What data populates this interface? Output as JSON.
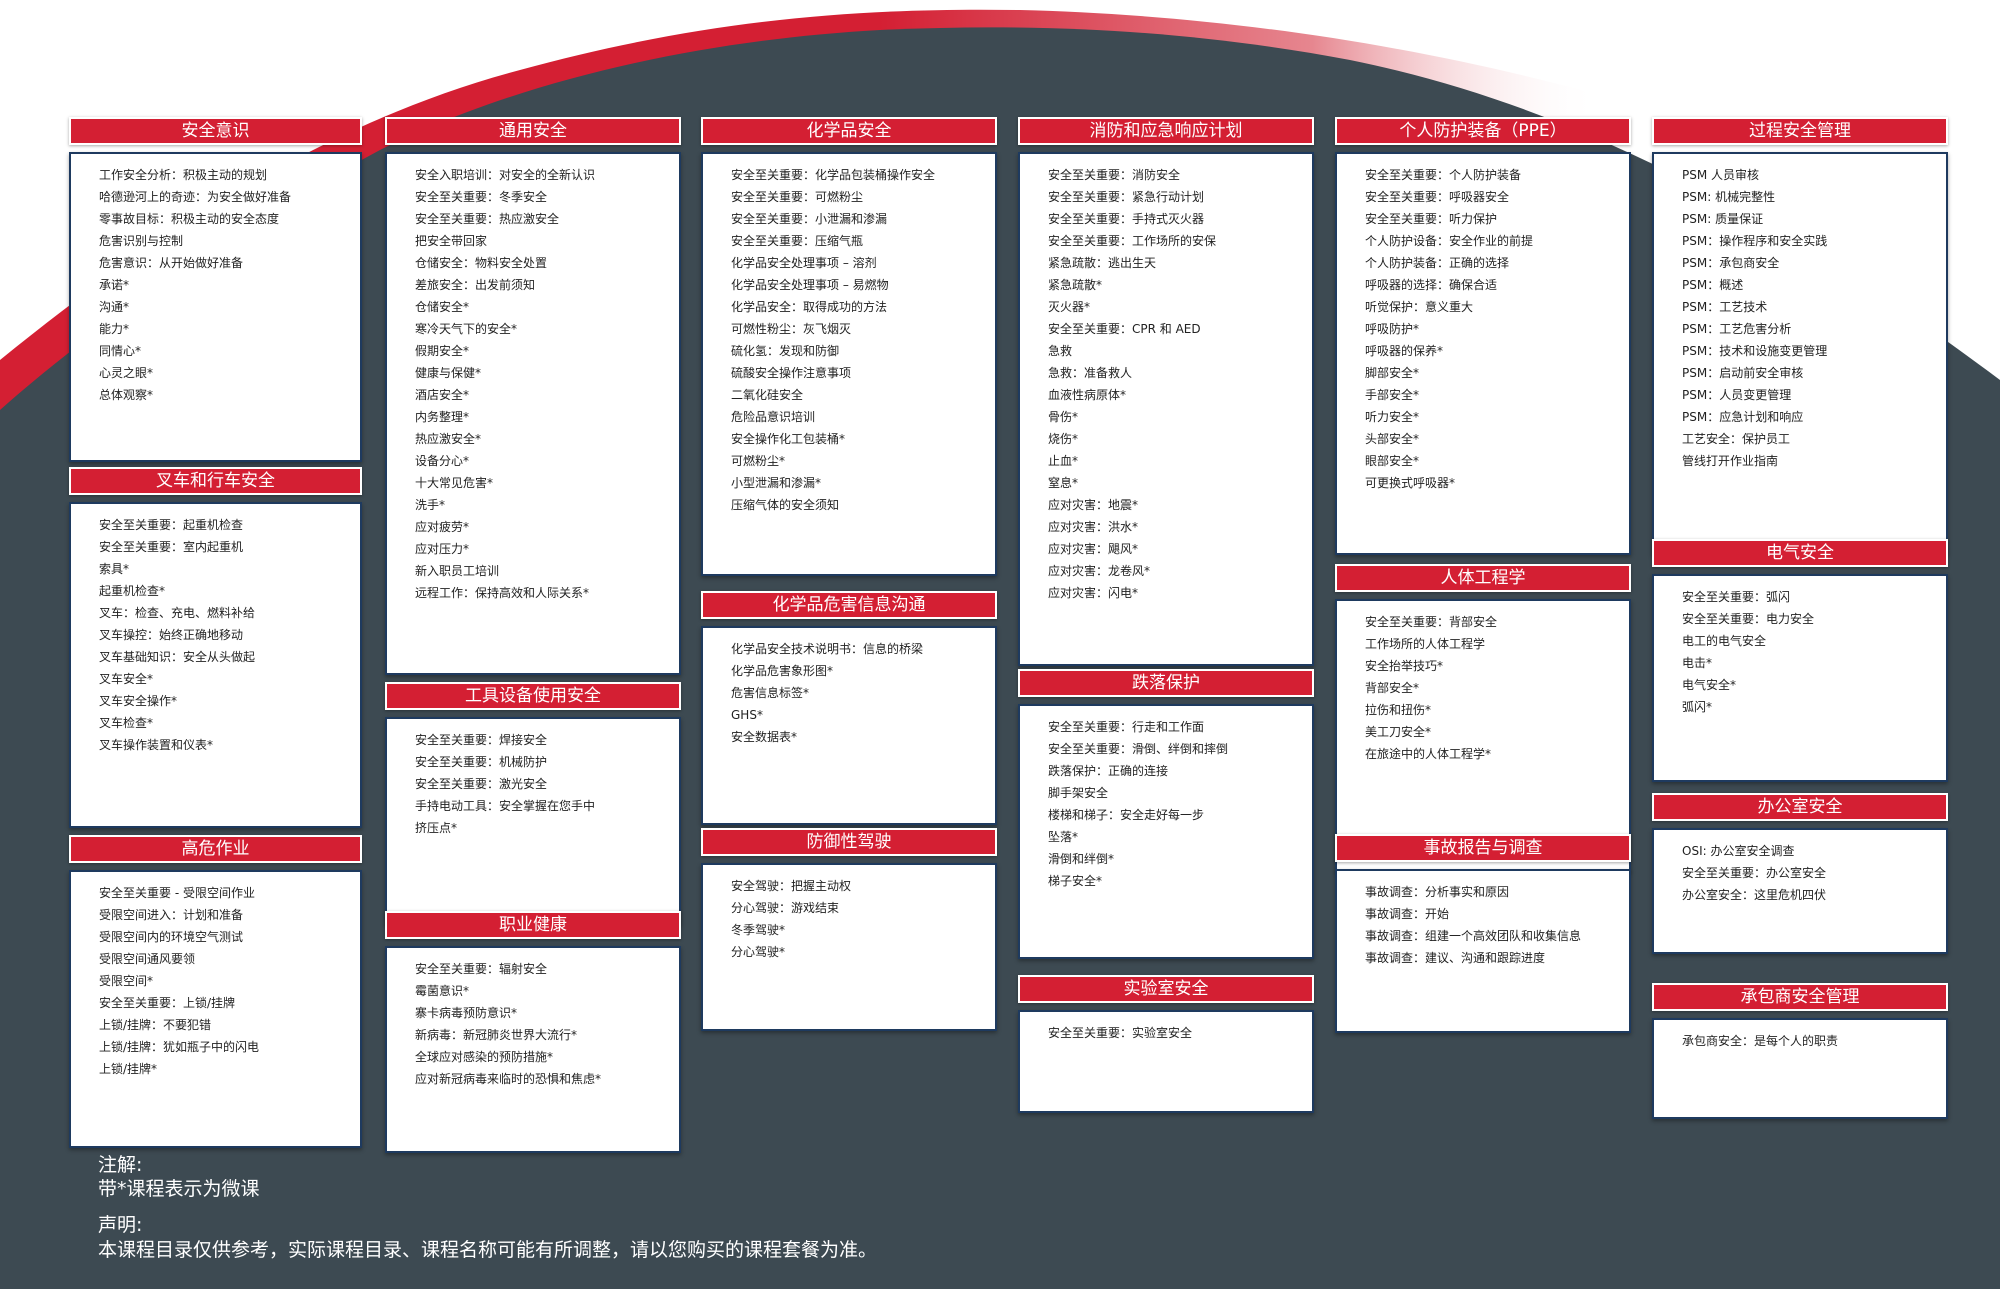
{
  "bullet_glyph": "►",
  "colors": {
    "accent": "#d41f33",
    "background": "#3d4a52",
    "card_border": "#1e3a5f"
  },
  "categories": [
    {
      "title": "安全意识",
      "items": [
        "工作安全分析：积极主动的规划",
        "哈德逊河上的奇迹：为安全做好准备",
        "零事故目标：积极主动的安全态度",
        "危害识别与控制",
        "危害意识：从开始做好准备",
        "承诺*",
        "沟通*",
        "能力*",
        "同情心*",
        "心灵之眼*",
        "总体观察*"
      ]
    },
    {
      "title": "叉车和行车安全",
      "items": [
        "安全至关重要：起重机检查",
        "安全至关重要：室内起重机",
        "索具*",
        "起重机检查*",
        "叉车：检查、充电、燃料补给",
        "叉车操控：始终正确地移动",
        "叉车基础知识：安全从头做起",
        "叉车安全*",
        "叉车安全操作*",
        "叉车检查*",
        "叉车操作装置和仪表*"
      ]
    },
    {
      "title": "高危作业",
      "items": [
        "安全至关重要 - 受限空间作业",
        "受限空间进入：计划和准备",
        "受限空间内的环境空气测试",
        "受限空间通风要领",
        "受限空间*",
        "安全至关重要：上锁/挂牌",
        "上锁/挂牌：不要犯错",
        "上锁/挂牌：犹如瓶子中的闪电",
        "上锁/挂牌*"
      ]
    },
    {
      "title": "通用安全",
      "items": [
        "安全入职培训：对安全的全新认识",
        "安全至关重要：冬季安全",
        "安全至关重要：热应激安全",
        "把安全带回家",
        "仓储安全：物料安全处置",
        "差旅安全：出发前须知",
        "仓储安全*",
        "寒冷天气下的安全*",
        "假期安全*",
        "健康与保健*",
        "酒店安全*",
        "内务整理*",
        "热应激安全*",
        "设备分心*",
        "十大常见危害*",
        "洗手*",
        "应对疲劳*",
        "应对压力*",
        "新入职员工培训",
        "远程工作：保持高效和人际关系*"
      ]
    },
    {
      "title": "工具设备使用安全",
      "items": [
        "安全至关重要：焊接安全",
        "安全至关重要：机械防护",
        "安全至关重要：激光安全",
        "手持电动工具：安全掌握在您手中",
        "挤压点*"
      ]
    },
    {
      "title": "职业健康",
      "items": [
        "安全至关重要：辐射安全",
        "霉菌意识*",
        "寨卡病毒预防意识*",
        "新病毒：新冠肺炎世界大流行*",
        "全球应对感染的预防措施*",
        "应对新冠病毒来临时的恐惧和焦虑*"
      ]
    },
    {
      "title": "化学品安全",
      "items": [
        "安全至关重要：化学品包装桶操作安全",
        "安全至关重要：可燃粉尘",
        "安全至关重要：小泄漏和渗漏",
        "安全至关重要：压缩气瓶",
        "化学品安全处理事项 – 溶剂",
        "化学品安全处理事项 – 易燃物",
        "化学品安全：取得成功的方法",
        "可燃性粉尘：灰飞烟灭",
        "硫化氢：发现和防御",
        "硫酸安全操作注意事项",
        "二氧化硅安全",
        "危险品意识培训",
        "安全操作化工包装桶*",
        "可燃粉尘*",
        "小型泄漏和渗漏*",
        "压缩气体的安全须知"
      ]
    },
    {
      "title": "化学品危害信息沟通",
      "items": [
        "化学品安全技术说明书：信息的桥梁",
        "化学品危害象形图*",
        "危害信息标签*",
        "GHS*",
        "安全数据表*"
      ]
    },
    {
      "title": "防御性驾驶",
      "items": [
        "安全驾驶：把握主动权",
        "分心驾驶：游戏结束",
        "冬季驾驶*",
        "分心驾驶*"
      ]
    },
    {
      "title": "消防和应急响应计划",
      "items": [
        "安全至关重要：消防安全",
        "安全至关重要：紧急行动计划",
        "安全至关重要：手持式灭火器",
        "安全至关重要：工作场所的安保",
        "紧急疏散：逃出生天",
        "紧急疏散*",
        "灭火器*",
        "安全至关重要：CPR 和 AED",
        "急救",
        "急救：准备救人",
        "血液性病原体*",
        "骨伤*",
        "烧伤*",
        "止血*",
        "窒息*",
        "应对灾害：地震*",
        "应对灾害：洪水*",
        "应对灾害：飓风*",
        "应对灾害：龙卷风*",
        "应对灾害：闪电*"
      ]
    },
    {
      "title": "跌落保护",
      "items": [
        "安全至关重要：行走和工作面",
        "安全至关重要：滑倒、绊倒和摔倒",
        "跌落保护：正确的连接",
        "脚手架安全",
        "楼梯和梯子：安全走好每一步",
        "坠落*",
        "滑倒和绊倒*",
        "梯子安全*"
      ]
    },
    {
      "title": "实验室安全",
      "items": [
        "安全至关重要：实验室安全"
      ]
    },
    {
      "title": "个人防护装备（PPE）",
      "items": [
        "安全至关重要：个人防护装备",
        "安全至关重要：呼吸器安全",
        "安全至关重要：听力保护",
        "个人防护设备：安全作业的前提",
        "个人防护装备：正确的选择",
        "呼吸器的选择：确保合适",
        "听觉保护：意义重大",
        "呼吸防护*",
        "呼吸器的保养*",
        "脚部安全*",
        "手部安全*",
        "听力安全*",
        "头部安全*",
        "眼部安全*",
        "可更换式呼吸器*"
      ]
    },
    {
      "title": "人体工程学",
      "items": [
        "安全至关重要：背部安全",
        "工作场所的人体工程学",
        "安全抬举技巧*",
        "背部安全*",
        "拉伤和扭伤*",
        "美工刀安全*",
        "在旅途中的人体工程学*"
      ]
    },
    {
      "title": "事故报告与调查",
      "items": [
        "事故调查：分析事实和原因",
        "事故调查：开始",
        "事故调查：组建一个高效团队和收集信息",
        "事故调查：建议、沟通和跟踪进度"
      ]
    },
    {
      "title": "过程安全管理",
      "items": [
        "PSM 人员审核",
        "PSM: 机械完整性",
        "PSM: 质量保证",
        "PSM：操作程序和安全实践",
        "PSM：承包商安全",
        "PSM：概述",
        "PSM：工艺技术",
        "PSM：工艺危害分析",
        "PSM：技术和设施变更管理",
        "PSM：启动前安全审核",
        "PSM：人员变更管理",
        "PSM：应急计划和响应",
        "工艺安全：保护员工",
        "管线打开作业指南"
      ]
    },
    {
      "title": "电气安全",
      "items": [
        "安全至关重要：弧闪",
        "安全至关重要：电力安全",
        "电工的电气安全",
        "电击*",
        "电气安全*",
        "弧闪*"
      ]
    },
    {
      "title": "办公室安全",
      "items": [
        "OSI: 办公室安全调查",
        "安全至关重要：办公室安全",
        "办公室安全：这里危机四伏"
      ]
    },
    {
      "title": "承包商安全管理",
      "items": [
        "承包商安全：是每个人的职责"
      ]
    }
  ],
  "notes": {
    "note_label": "注解:",
    "note_text": "带*课程表示为微课",
    "statement_label": "声明:",
    "statement_text": "本课程目录仅供参考，实际课程目录、课程名称可能有所调整，请以您购买的课程套餐为准。"
  }
}
